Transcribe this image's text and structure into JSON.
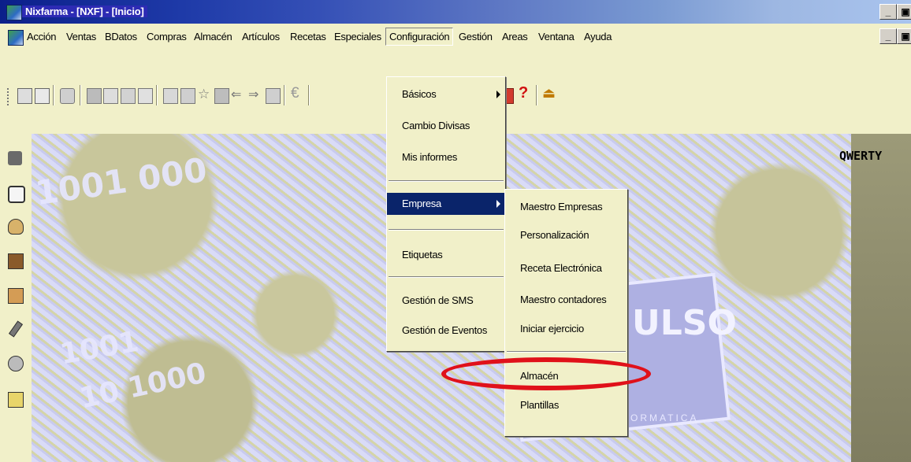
{
  "window": {
    "title": "Nixfarma - [NXF] - [Inicio]",
    "min_glyph": "_",
    "restore_glyph": "▣",
    "close_glyph": "x"
  },
  "menubar": {
    "items": [
      "Acción",
      "Ventas",
      "BDatos",
      "Compras",
      "Almacén",
      "Artículos",
      "Recetas",
      "Especiales",
      "Configuración",
      "Gestión",
      "Areas",
      "Ventana",
      "Ayuda"
    ],
    "active": "Configuración"
  },
  "toolbar": {
    "icons": [
      "toolbar-grip-icon",
      "form-icon",
      "edit-form-icon",
      "disk-icon",
      "report-icon",
      "checklist-icon",
      "cancel-doc-icon",
      "print-doc-icon",
      "list-icon",
      "table-icon",
      "star-icon",
      "door-icon",
      "arrow-left-icon",
      "arrow-right-icon",
      "exit-icon",
      "euro-icon",
      "help-icon",
      "question-mark-icon",
      "upload-icon"
    ],
    "question_glyph": "?",
    "euro_glyph": "€"
  },
  "left_toolbar": {
    "icons": [
      "cash-register-icon",
      "document-icon",
      "person-icon",
      "shopping-cart-icon",
      "factory-icon",
      "pencil-icon",
      "users-icon",
      "printer-icon"
    ]
  },
  "config_menu": {
    "items": [
      {
        "label": "Básicos",
        "submenu": true
      },
      {
        "label": "Cambio Divisas"
      },
      {
        "label": "Mis informes"
      },
      {
        "label": "Empresa",
        "submenu": true,
        "highlighted": true
      },
      {
        "label": "Etiquetas"
      },
      {
        "label": "Gestión de SMS"
      },
      {
        "label": "Gestión de Eventos"
      }
    ]
  },
  "empresa_submenu": {
    "items": [
      "Maestro Empresas",
      "Personalización",
      "Receta Electrónica",
      "Maestro contadores",
      "Iniciar ejercicio",
      "Almacén",
      "Plantillas"
    ]
  },
  "background": {
    "corner_label": "QWERTY",
    "logo_text": "ULSO",
    "logo_subtext": "ORMATICA",
    "digits_a": "1001 000",
    "digits_b": "1001",
    "digits_c": "10 1000"
  },
  "colors": {
    "menu_bg": "#f1f0c9",
    "selection": "#0a246a",
    "annotation": "#e0111a"
  }
}
